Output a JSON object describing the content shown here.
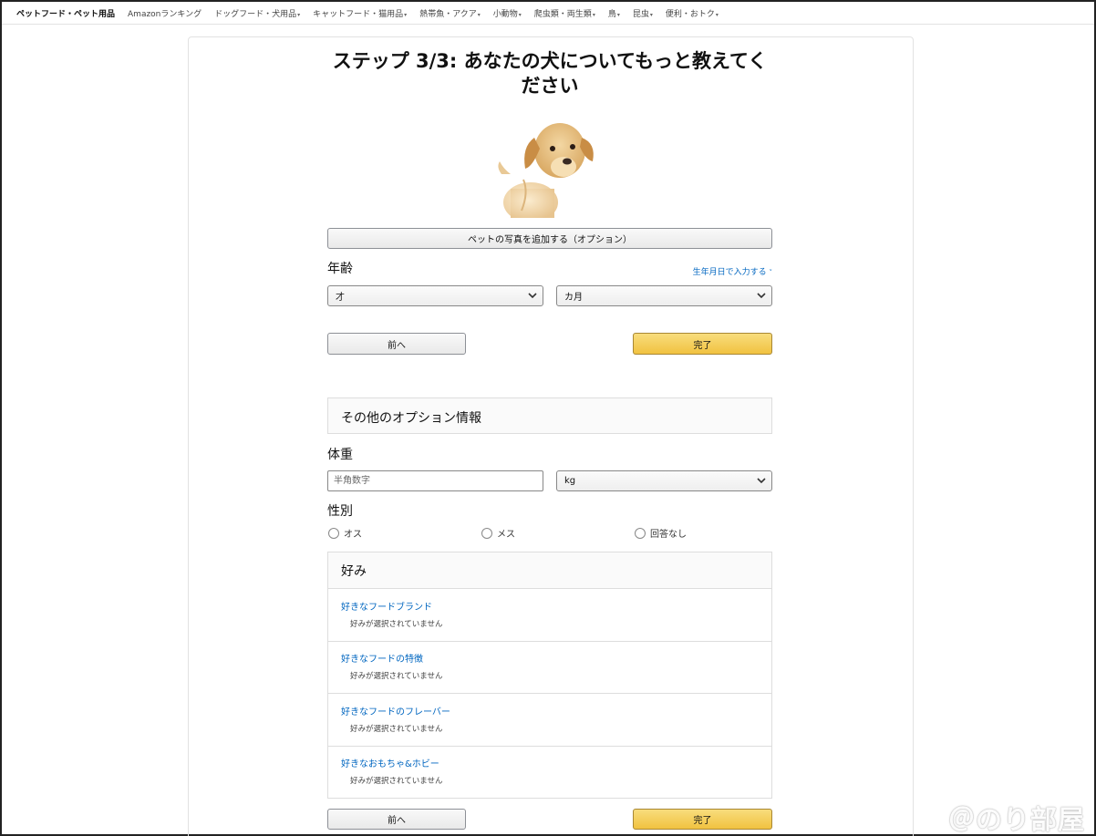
{
  "topnav": {
    "brand": "ペットフード・ペット用品",
    "items": [
      {
        "label": "Amazonランキング",
        "caret": false
      },
      {
        "label": "ドッグフード・犬用品",
        "caret": true
      },
      {
        "label": "キャットフード・猫用品",
        "caret": true
      },
      {
        "label": "熱帯魚・アクア",
        "caret": true
      },
      {
        "label": "小動物",
        "caret": true
      },
      {
        "label": "爬虫類・両生類",
        "caret": true
      },
      {
        "label": "鳥",
        "caret": true
      },
      {
        "label": "昆虫",
        "caret": true
      },
      {
        "label": "便利・おトク",
        "caret": true
      }
    ]
  },
  "page": {
    "title": "ステップ 3/3: あなたの犬についてもっと教えてください",
    "add_photo_label": "ペットの写真を追加する（オプション）"
  },
  "age": {
    "label": "年齢",
    "dob_link": "生年月日で入力する",
    "years_value": "才",
    "months_value": "カ月"
  },
  "nav_buttons_top": {
    "prev": "前へ",
    "done": "完了"
  },
  "optional": {
    "section_title": "その他のオプション情報",
    "weight_label": "体重",
    "weight_placeholder": "半角数字",
    "weight_unit": "kg",
    "gender_label": "性別",
    "gender_options": [
      "オス",
      "メス",
      "回答なし"
    ]
  },
  "preferences": {
    "title": "好み",
    "items": [
      {
        "label": "好きなフードブランド",
        "status": "好みが選択されていません"
      },
      {
        "label": "好きなフードの特徴",
        "status": "好みが選択されていません"
      },
      {
        "label": "好きなフードのフレーバー",
        "status": "好みが選択されていません"
      },
      {
        "label": "好きなおもちゃ&ホビー",
        "status": "好みが選択されていません"
      }
    ]
  },
  "nav_buttons_bottom": {
    "prev": "前へ",
    "done": "完了"
  },
  "watermark": "＠のり部屋",
  "colors": {
    "link": "#0066c0",
    "primary_button": "#f0c14b"
  }
}
